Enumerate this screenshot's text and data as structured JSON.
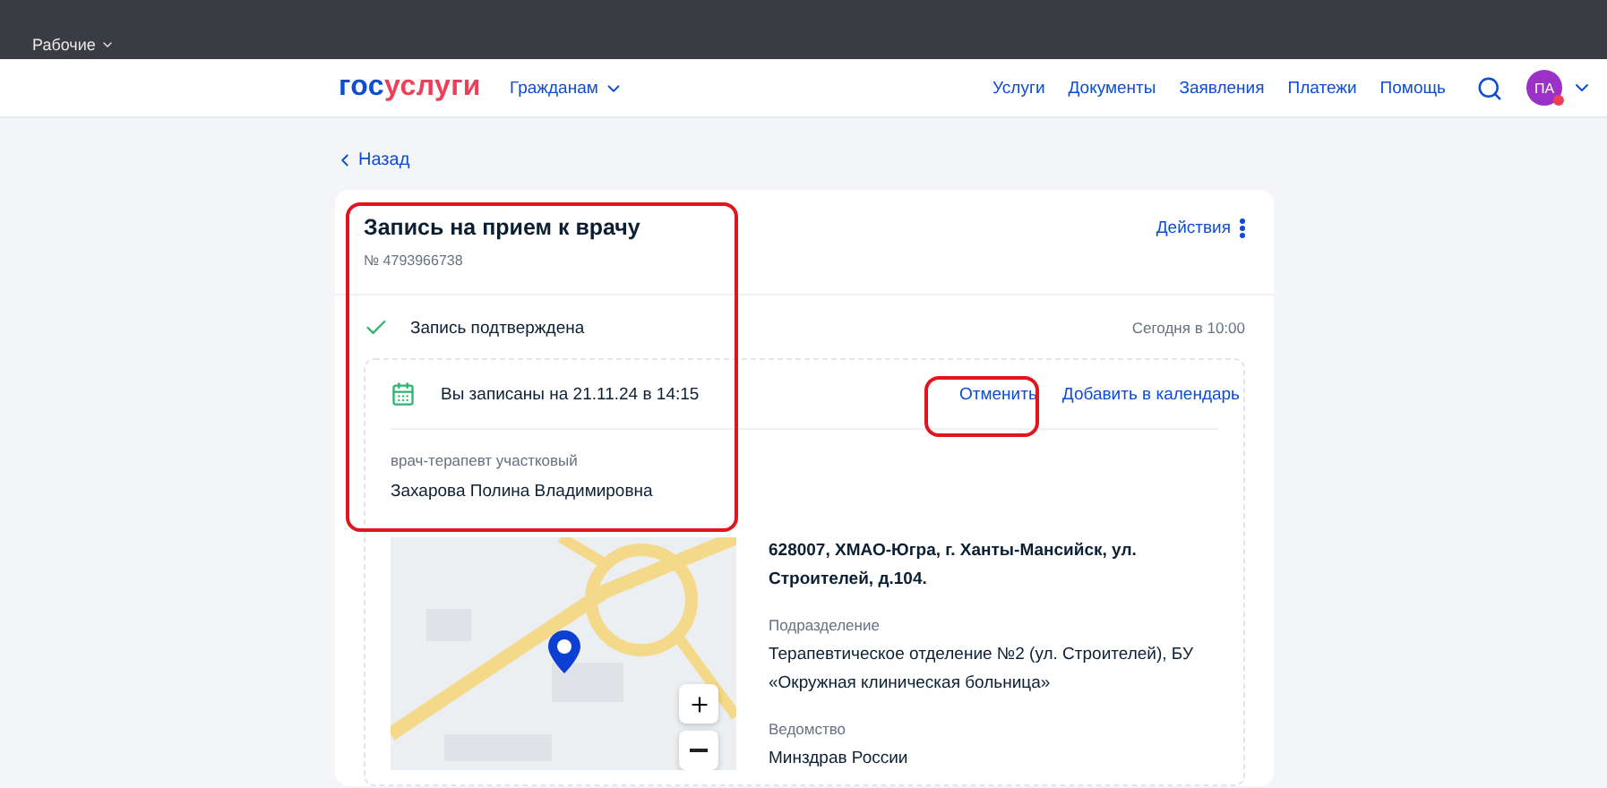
{
  "browser": {
    "bookmarks": [
      "Рабочие"
    ]
  },
  "header": {
    "logo": [
      "гос",
      "услуги"
    ],
    "audience": "Гражданам",
    "nav": [
      "Услуги",
      "Документы",
      "Заявления",
      "Платежи",
      "Помощь"
    ],
    "avatar": "ПА",
    "notification": true
  },
  "back": "Назад",
  "card": {
    "title": "Запись на прием к врачу",
    "number": "№ 4793966738",
    "actions": "Действия",
    "status": {
      "label": "Запись подтверждена",
      "time": "Сегодня в 10:00"
    },
    "appointment": {
      "text": "Вы записаны на 21.11.24 в 14:15",
      "cancel": "Отменить",
      "add_to_calendar": "Добавить в календарь",
      "role": "врач-терапевт участковый",
      "doctor": "Захарова Полина Владимировна"
    },
    "address": "628007, ХМАО-Югра, г. Ханты-Мансийск, ул. Строителей, д.104.",
    "details": [
      {
        "label": "Подразделение",
        "value": "Терапевтическое отделение №2 (ул. Строителей), БУ «Окружная клиническая больница»"
      },
      {
        "label": "Ведомство",
        "value": "Минздрав России"
      }
    ]
  }
}
